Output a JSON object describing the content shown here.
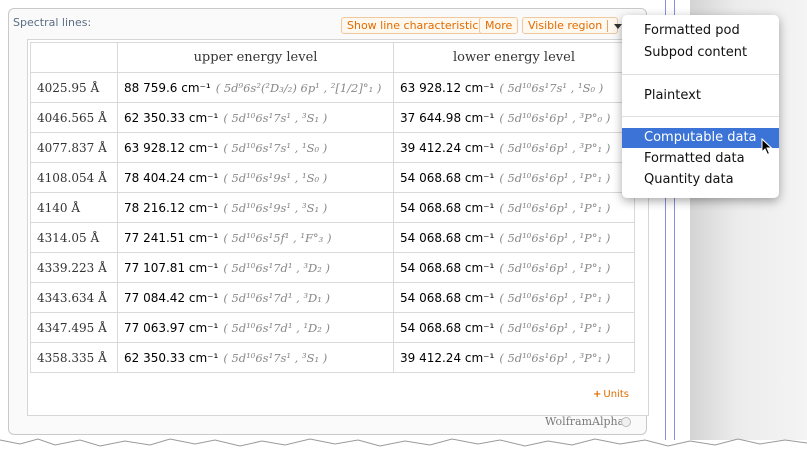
{
  "pod": {
    "title": "Spectral lines:",
    "buttons": {
      "show_line_characteristics": "Show line characteristics",
      "more": "More",
      "visible_region": "Visible region"
    },
    "units_label": "Units",
    "units_plus": "+",
    "brand": "WolframAlpha"
  },
  "table": {
    "headers": [
      "upper energy level",
      "lower energy level"
    ],
    "rows": [
      {
        "wavelength": "4025.95 Å",
        "upper_value": "88 759.6 cm⁻¹",
        "upper_config": "( 5d⁹6s²(²D₃/₂) 6p¹ , ²[1/2]°₁ )",
        "lower_value": "63 928.12 cm⁻¹",
        "lower_config": "( 5d¹⁰6s¹7s¹ , ¹S₀ )"
      },
      {
        "wavelength": "4046.565 Å",
        "upper_value": "62 350.33 cm⁻¹",
        "upper_config": "( 5d¹⁰6s¹7s¹ , ³S₁ )",
        "lower_value": "37 644.98 cm⁻¹",
        "lower_config": "( 5d¹⁰6s¹6p¹ , ³P°₀ )"
      },
      {
        "wavelength": "4077.837 Å",
        "upper_value": "63 928.12 cm⁻¹",
        "upper_config": "( 5d¹⁰6s¹7s¹ , ¹S₀ )",
        "lower_value": "39 412.24 cm⁻¹",
        "lower_config": "( 5d¹⁰6s¹6p¹ , ³P°₁ )"
      },
      {
        "wavelength": "4108.054 Å",
        "upper_value": "78 404.24 cm⁻¹",
        "upper_config": "( 5d¹⁰6s¹9s¹ , ¹S₀ )",
        "lower_value": "54 068.68 cm⁻¹",
        "lower_config": "( 5d¹⁰6s¹6p¹ , ¹P°₁ )"
      },
      {
        "wavelength": "4140 Å",
        "upper_value": "78 216.12 cm⁻¹",
        "upper_config": "( 5d¹⁰6s¹9s¹ , ³S₁ )",
        "lower_value": "54 068.68 cm⁻¹",
        "lower_config": "( 5d¹⁰6s¹6p¹ , ¹P°₁ )"
      },
      {
        "wavelength": "4314.05 Å",
        "upper_value": "77 241.51 cm⁻¹",
        "upper_config": "( 5d¹⁰6s¹5f¹ , ¹F°₃ )",
        "lower_value": "54 068.68 cm⁻¹",
        "lower_config": "( 5d¹⁰6s¹6p¹ , ¹P°₁ )"
      },
      {
        "wavelength": "4339.223 Å",
        "upper_value": "77 107.81 cm⁻¹",
        "upper_config": "( 5d¹⁰6s¹7d¹ , ³D₂ )",
        "lower_value": "54 068.68 cm⁻¹",
        "lower_config": "( 5d¹⁰6s¹6p¹ , ¹P°₁ )"
      },
      {
        "wavelength": "4343.634 Å",
        "upper_value": "77 084.42 cm⁻¹",
        "upper_config": "( 5d¹⁰6s¹7d¹ , ³D₁ )",
        "lower_value": "54 068.68 cm⁻¹",
        "lower_config": "( 5d¹⁰6s¹6p¹ , ¹P°₁ )"
      },
      {
        "wavelength": "4347.495 Å",
        "upper_value": "77 063.97 cm⁻¹",
        "upper_config": "( 5d¹⁰6s¹7d¹ , ¹D₂ )",
        "lower_value": "54 068.68 cm⁻¹",
        "lower_config": "( 5d¹⁰6s¹6p¹ , ¹P°₁ )"
      },
      {
        "wavelength": "4358.335 Å",
        "upper_value": "62 350.33 cm⁻¹",
        "upper_config": "( 5d¹⁰6s¹7s¹ , ³S₁ )",
        "lower_value": "39 412.24 cm⁻¹",
        "lower_config": "( 5d¹⁰6s¹6p¹ , ³P°₁ )"
      }
    ]
  },
  "context_menu": {
    "items": [
      "Formatted pod",
      "Subpod content",
      "Plaintext",
      "Computable data",
      "Formatted data",
      "Quantity data"
    ],
    "selected": "Computable data"
  },
  "colors": {
    "accent_orange": "#e26b00",
    "menu_highlight": "#3b73d6",
    "title_blue": "#5a6e84"
  }
}
